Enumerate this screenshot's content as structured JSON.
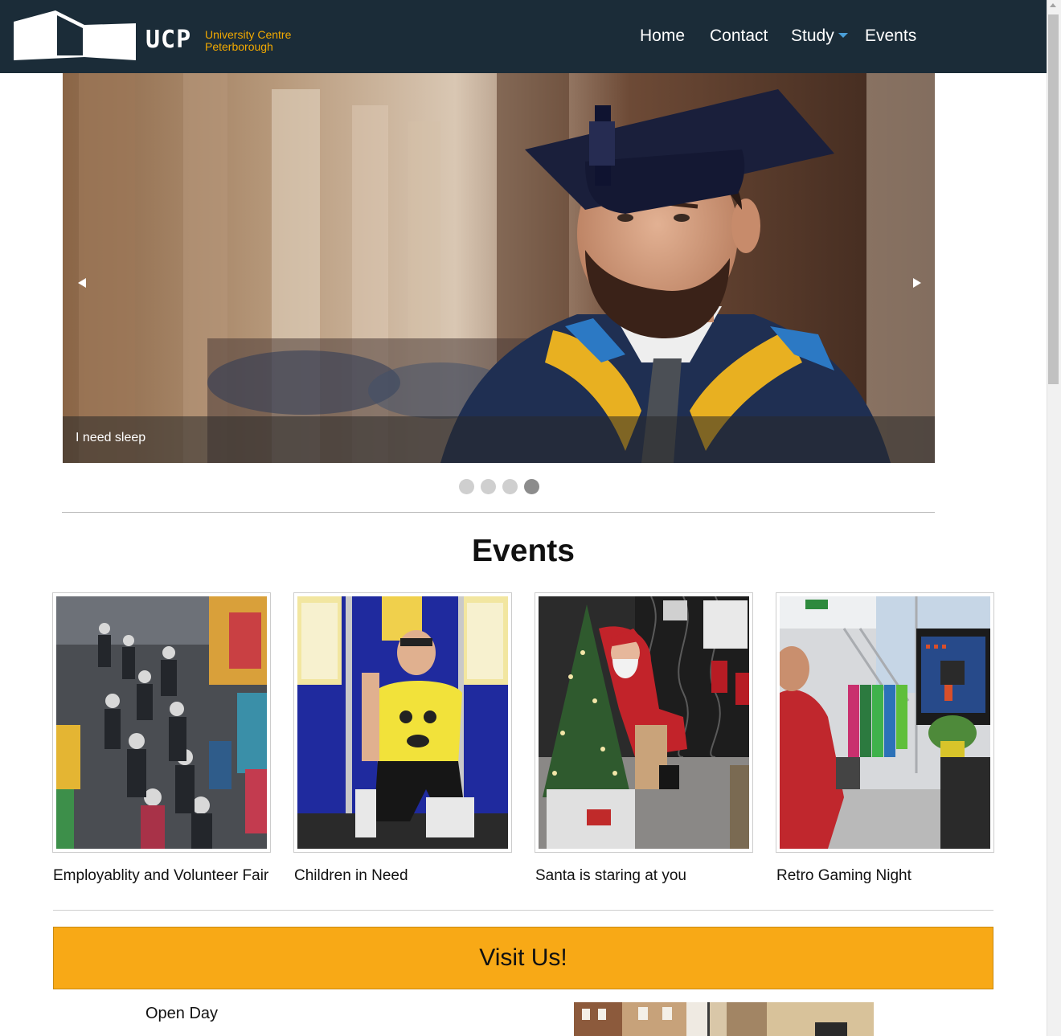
{
  "header": {
    "logo": {
      "abbr": "UCP",
      "line1": "University Centre",
      "line2": "Peterborough"
    },
    "nav": [
      {
        "label": "Home"
      },
      {
        "label": "Contact"
      },
      {
        "label": "Study"
      },
      {
        "label": "Events"
      }
    ]
  },
  "carousel": {
    "caption": "I need sleep",
    "slide_count": 4,
    "active_slide": 4
  },
  "events": {
    "heading": "Events",
    "items": [
      {
        "title": "Employablity and Volunteer Fair"
      },
      {
        "title": "Children in Need"
      },
      {
        "title": "Santa is staring at you"
      },
      {
        "title": "Retro Gaming Night"
      }
    ]
  },
  "visit": {
    "banner": "Visit Us!",
    "open_day": "Open Day"
  },
  "colors": {
    "header_bg": "#1b2c38",
    "logo_accent": "#f2a900",
    "visit_banner": "#f8a916",
    "nav_caret": "#4a9fd8"
  }
}
